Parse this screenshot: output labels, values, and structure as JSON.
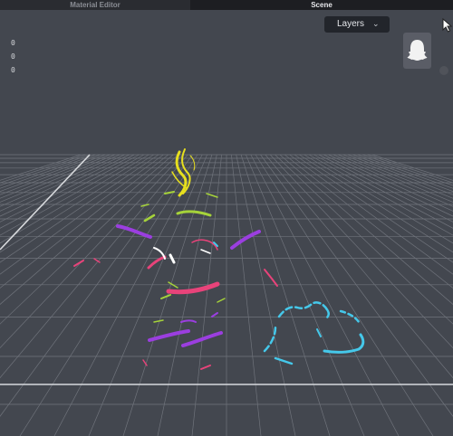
{
  "tabs": [
    {
      "label": "Material Editor",
      "active": false
    },
    {
      "label": "Scene",
      "active": true
    }
  ],
  "coordinates": [
    "0",
    "0",
    "0"
  ],
  "layers_dropdown": {
    "label": "Layers",
    "icon": "chevron-down-icon"
  },
  "icons": {
    "ghost": "ghost-icon",
    "cursor": "cursor-arrow-icon",
    "settings": "gear-icon"
  },
  "colors": {
    "viewport": "#43474f",
    "grid": "#6f737b",
    "yellow": "#e7df1e",
    "lime": "#a6d33a",
    "purple": "#9b3ee0",
    "pink": "#e8437a",
    "cyan": "#45c8ea",
    "white": "#ffffff"
  }
}
